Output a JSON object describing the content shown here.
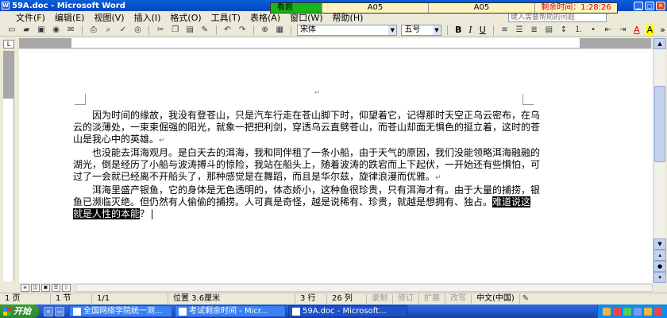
{
  "window": {
    "title": "59A.doc - Microsoft Word",
    "app_icon": "W"
  },
  "menus": [
    "文件(F)",
    "编辑(E)",
    "视图(V)",
    "插入(I)",
    "格式(O)",
    "工具(T)",
    "表格(A)",
    "窗口(W)",
    "帮助(H)"
  ],
  "help_box": "键入需要帮助的问题",
  "exam_bar": {
    "label": "看题",
    "cell1": "A05",
    "cell2": "A05",
    "time": "剩余时间：1:28:26",
    "color_label": "#19b519",
    "color_time": "#d00000"
  },
  "toolbar": {
    "font_name": "宋体",
    "font_size": "五号",
    "bold": "B",
    "italic": "I",
    "underline": "U",
    "font_color_label": "A",
    "highlight_label": "A",
    "more": "»"
  },
  "document": {
    "paragraphs": [
      {
        "text": "因为时间的缘故，我没有登苍山，只是汽车行走在苍山脚下时，仰望着它，记得那时天空正乌云密布，在乌云的淡薄处，一束束倔强的阳光，就象一把把利剑，穿透乌云直劈苍山，而苍山却面无惧色的挺立着，这时的苍山是我心中的英雄。",
        "mark": "↵"
      },
      {
        "text": "也没能去洱海观月。是白天去的洱海，我和同伴租了一条小船，由于天气的原因，我们没能领略洱海融融的湖光，倒是经历了小船与波涛搏斗的惊险，我站在船头上，随着波涛的跌宕而上下起伏，一开始还有些惧怕，可过了一会就已经离不开船头了，那种感觉是在舞蹈，而且是华尔兹，旋律浪漫而优雅。",
        "mark": "↵"
      },
      {
        "text_before": "洱海里盛产银鱼，它的身体是无色透明的，体态娇小，这种鱼很珍贵，只有洱海才有。由于大量的捕捞，银鱼已濒临灭绝。但仍然有人偷偷的捕捞。人可真是奇怪，越是说稀有、珍贵，就越是想拥有、独占。",
        "selected": "难道说这就是人性的本能",
        "text_after": "？"
      }
    ],
    "top_mark": "↵"
  },
  "status": {
    "page": "1 页",
    "section": "1 节",
    "page_of": "1/1",
    "position": "位置 3.6厘米",
    "line": "3 行",
    "column": "26 列",
    "rec": "录制",
    "trk": "修订",
    "ext": "扩展",
    "ovr": "改写",
    "language": "中文(中国)"
  },
  "taskbar": {
    "start": "开始",
    "tasks": [
      {
        "label": "全国网络学院统一测...",
        "active": false
      },
      {
        "label": "考试剩余时间 - Micr...",
        "active": false
      },
      {
        "label": "59A.doc - Microsoft...",
        "active": true
      }
    ]
  }
}
